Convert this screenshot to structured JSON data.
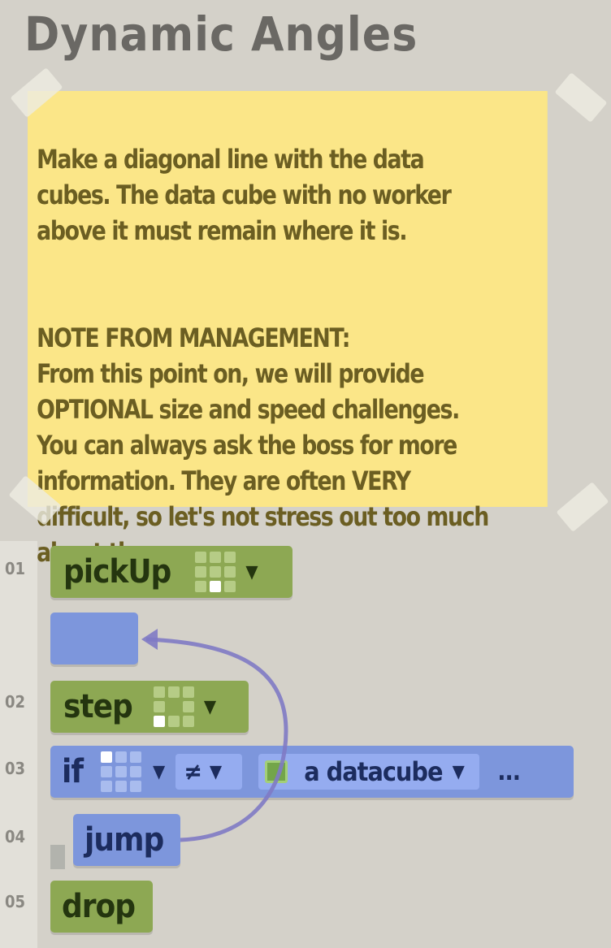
{
  "level": {
    "title": "Dynamic Angles"
  },
  "note": {
    "paragraph1": "Make a diagonal line with the data\ncubes. The data cube with no worker\nabove it must remain where it is.",
    "paragraph2": "NOTE FROM MANAGEMENT:\nFrom this point on, we will provide\nOPTIONAL size and speed challenges.\nYou can always ask the boss for more\ninformation. They are often VERY\ndifficult, so let's not stress out too much\nabout them."
  },
  "program": {
    "line_numbers": [
      "01",
      "02",
      "03",
      "04",
      "05"
    ],
    "commands": [
      {
        "line": "01",
        "keyword": "pickUp",
        "direction": "down"
      },
      {
        "line": "",
        "keyword": "",
        "type": "jump-target"
      },
      {
        "line": "02",
        "keyword": "step",
        "direction": "down-left"
      },
      {
        "line": "03",
        "keyword": "if",
        "direction": "all",
        "operator": "≠",
        "target": "a datacube",
        "overflow": "..."
      },
      {
        "line": "04",
        "keyword": "jump"
      },
      {
        "line": "05",
        "keyword": "drop"
      }
    ],
    "colors": {
      "action": "#8da853",
      "flow": "#7d96dc",
      "arrow": "#7f7ac4"
    }
  }
}
